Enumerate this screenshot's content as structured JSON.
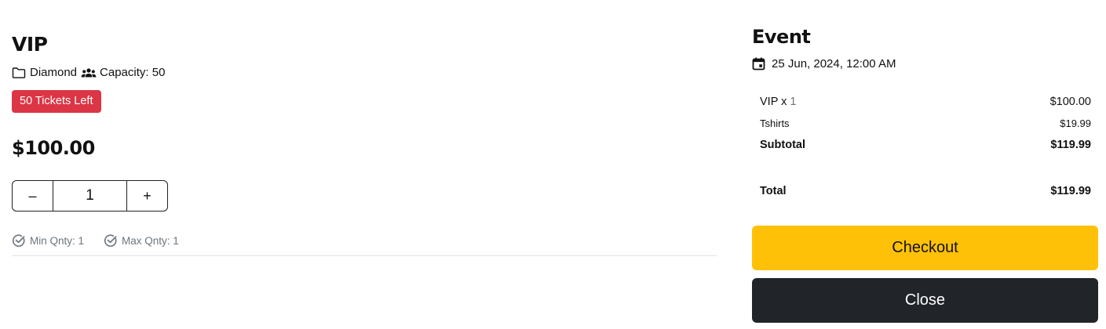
{
  "ticket": {
    "name": "VIP",
    "category": "Diamond",
    "capacity": "Capacity: 50",
    "tickets_left": "50 Tickets Left",
    "price": "$100.00",
    "quantity": "1",
    "decrement_label": "–",
    "increment_label": "+",
    "min_qty": "Min Qnty: 1",
    "max_qty": "Max Qnty: 1",
    "badge_color": "#dc3545"
  },
  "event": {
    "title": "Event",
    "date": "25 Jun, 2024, 12:00 AM"
  },
  "summary": {
    "ticket_label": "VIP x",
    "ticket_qty": "1",
    "ticket_price": "$100.00",
    "addon_label": "Tshirts",
    "addon_price": "$19.99",
    "subtotal_label": "Subtotal",
    "subtotal_value": "$119.99",
    "total_label": "Total",
    "total_value": "$119.99"
  },
  "actions": {
    "checkout_label": "Checkout",
    "close_label": "Close",
    "checkout_color": "#ffc107",
    "close_color": "#212529"
  },
  "icons": {
    "category": "folder-icon",
    "capacity": "people-icon",
    "min": "check-circle-icon",
    "max": "check-circle-icon",
    "date": "calendar-icon"
  }
}
